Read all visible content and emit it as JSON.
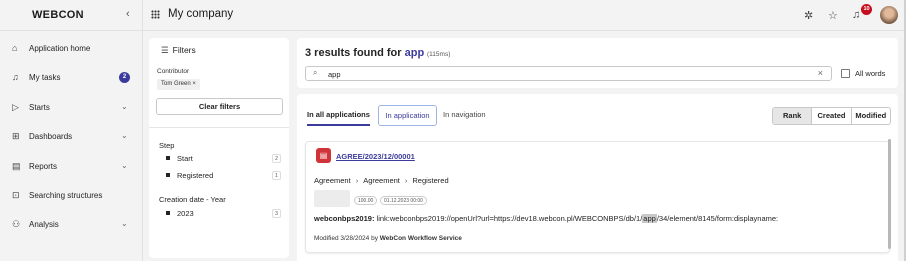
{
  "header": {
    "logo": "WEBCON",
    "collapse_icon": "chevron-left-icon",
    "apps_icon": "grid-icon",
    "company": "My company",
    "notifications_count": "10",
    "icons": [
      "puzzle-icon",
      "star-icon",
      "bell-icon",
      "avatar"
    ]
  },
  "nav": {
    "items": [
      {
        "label": "Application home",
        "icon": "home-icon",
        "chevron": false
      },
      {
        "label": "My tasks",
        "icon": "bell-icon",
        "badge": "2"
      },
      {
        "label": "Starts",
        "icon": "play-icon",
        "chevron": true
      },
      {
        "label": "Dashboards",
        "icon": "dashboard-icon",
        "chevron": true
      },
      {
        "label": "Reports",
        "icon": "report-icon",
        "chevron": true
      },
      {
        "label": "Searching structures",
        "icon": "search-structure-icon",
        "chevron": false
      },
      {
        "label": "Analysis",
        "icon": "analysis-icon",
        "chevron": true
      }
    ]
  },
  "filters": {
    "title": "Filters",
    "contributor_label": "Contributor",
    "contributor_chip": "Tom Green ×",
    "clear_label": "Clear filters",
    "step_label": "Step",
    "steps": [
      {
        "label": "Start",
        "count": "2"
      },
      {
        "label": "Registered",
        "count": "1"
      }
    ],
    "date_label": "Creation date - Year",
    "years": [
      {
        "label": "2023",
        "count": "3"
      }
    ]
  },
  "search": {
    "results_prefix": "3 results found for",
    "query": "app",
    "time": "(115ms)",
    "input_value": "app",
    "all_words_label": "All words"
  },
  "tabs": [
    "In all applications",
    "In application",
    "In navigation"
  ],
  "sort": [
    "Rank",
    "Created",
    "Modified"
  ],
  "result": {
    "signature": "AGREE/2023/12/00001",
    "path": [
      "Agreement",
      "Agreement",
      "Registered"
    ],
    "chip_value": "100.00",
    "chip_date": "01.12.2023 00:00",
    "desc_key": "webconbps2019:",
    "desc_before": " link:webconbps2019://openUrl?url=https://dev18.webcon.pl/WEBCONBPS/db/1/",
    "desc_highlight": "app",
    "desc_after": "/34/element/8145/form:displayname:",
    "modified_prefix": "Modified 3/28/2024 by",
    "modified_by": "WebCon Workflow Service"
  }
}
